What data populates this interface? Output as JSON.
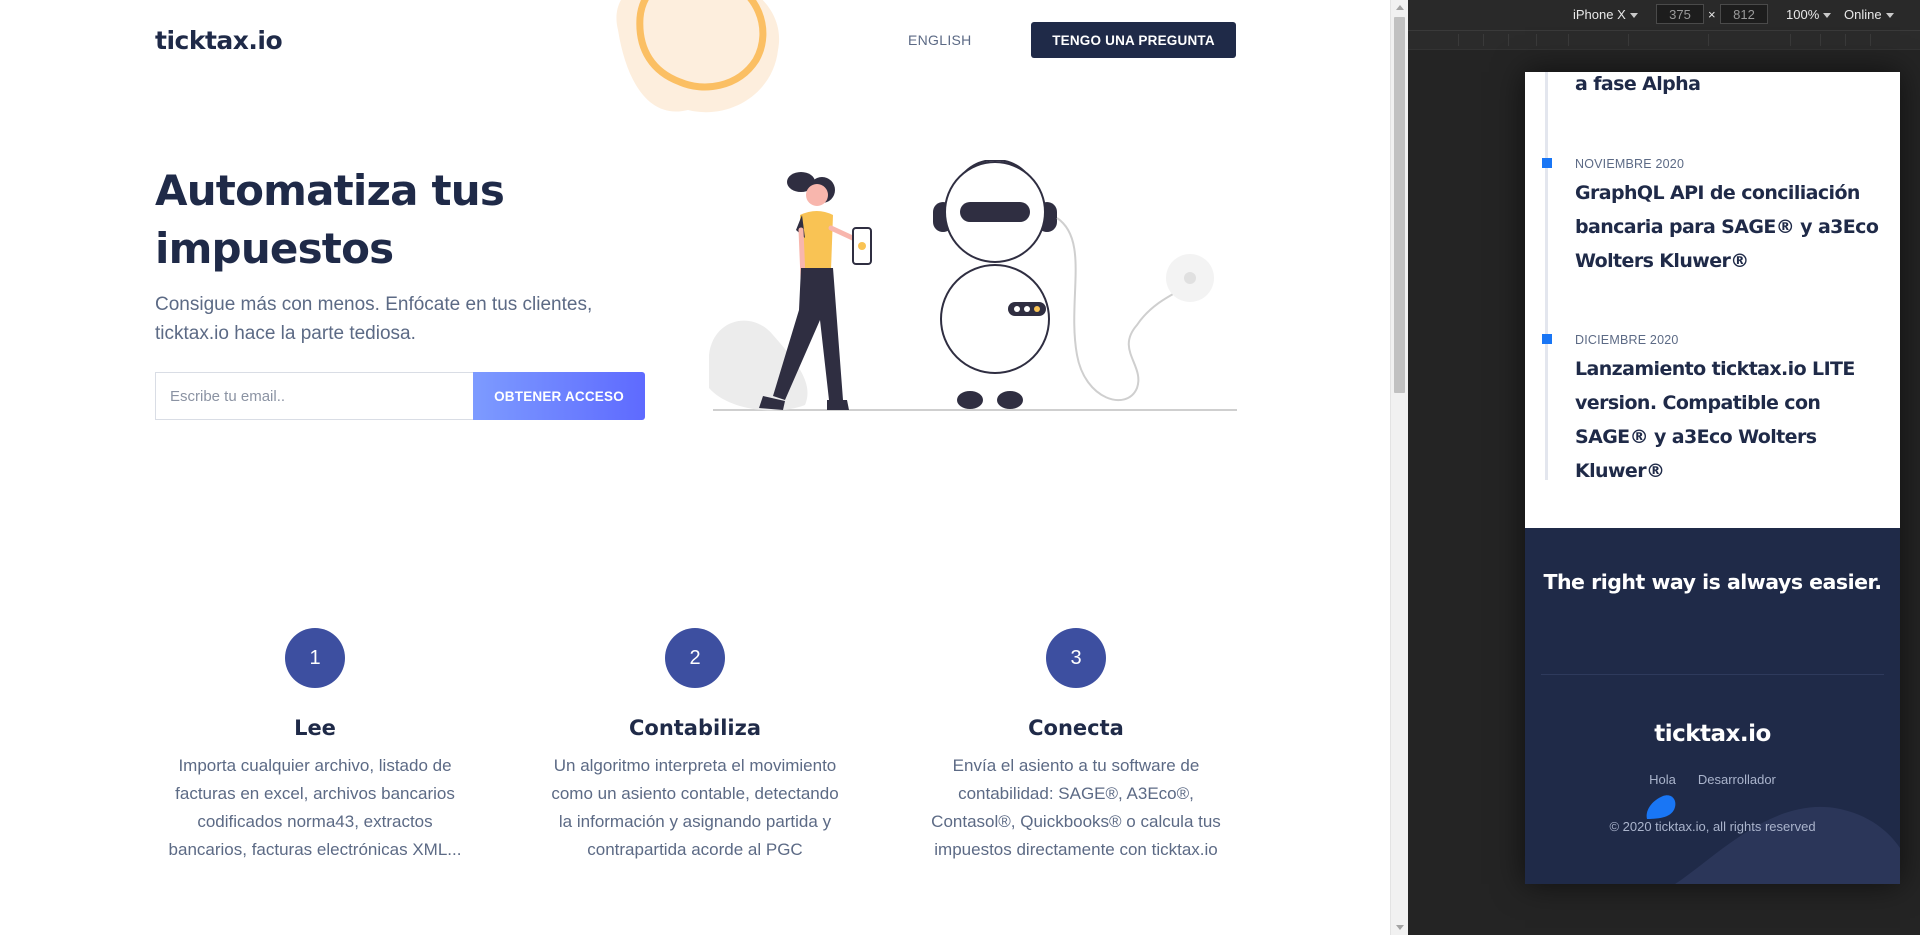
{
  "page": {
    "header": {
      "logo": "ticktax.io",
      "language_link": "ENGLISH",
      "cta_button": "TENGO UNA PREGUNTA"
    },
    "hero": {
      "title_line1": "Automatiza tus",
      "title_line2": "impuestos",
      "subtitle_line1": "Consigue más con menos. Enfócate en tus clientes,",
      "subtitle_line2": "ticktax.io hace la parte tediosa.",
      "email_placeholder": "Escribe tu email..",
      "access_button": "OBTENER ACCESO"
    },
    "steps": [
      {
        "number": "1",
        "title": "Lee",
        "description": "Importa cualquier archivo, listado de facturas en excel, archivos bancarios codificados norma43, extractos bancarios, facturas electrónicas XML..."
      },
      {
        "number": "2",
        "title": "Contabiliza",
        "description": "Un algoritmo interpreta el movimiento como un asiento contable, detectando la información y asignando partida y contrapartida acorde al PGC"
      },
      {
        "number": "3",
        "title": "Conecta",
        "description": "Envía el asiento a tu software de contabilidad: SAGE®, A3Eco®, Contasol®, Quickbooks® o calcula tus impuestos directamente con ticktax.io"
      }
    ]
  },
  "devtools": {
    "device": "iPhone X",
    "width": "375",
    "height": "812",
    "zoom": "100%",
    "network": "Online"
  },
  "mobile": {
    "timeline": [
      {
        "date": "",
        "title": "a fase Alpha"
      },
      {
        "date": "NOVIEMBRE 2020",
        "title": "GraphQL API de conciliación bancaria para SAGE® y a3Eco Wolters Kluwer®"
      },
      {
        "date": "DICIEMBRE 2020",
        "title": "Lanzamiento ticktax.io LITE version. Compatible con SAGE® y a3Eco Wolters Kluwer®"
      }
    ],
    "footer": {
      "tagline": "The right way is always easier.",
      "logo": "ticktax.io",
      "links": [
        "Hola",
        "Desarrollador"
      ],
      "copyright": "© 2020 ticktax.io, all rights reserved"
    }
  },
  "colors": {
    "navy": "#1f2a48",
    "text_muted": "#5c6a85",
    "step_circle": "#3d4fa0",
    "button_gradient_start": "#7d9bff",
    "button_gradient_end": "#5e6aff",
    "timeline_accent": "#1976f5",
    "blob_light": "#fdeedd",
    "blob_ring": "#fbbf63",
    "illustration_yellow": "#f9c354"
  }
}
